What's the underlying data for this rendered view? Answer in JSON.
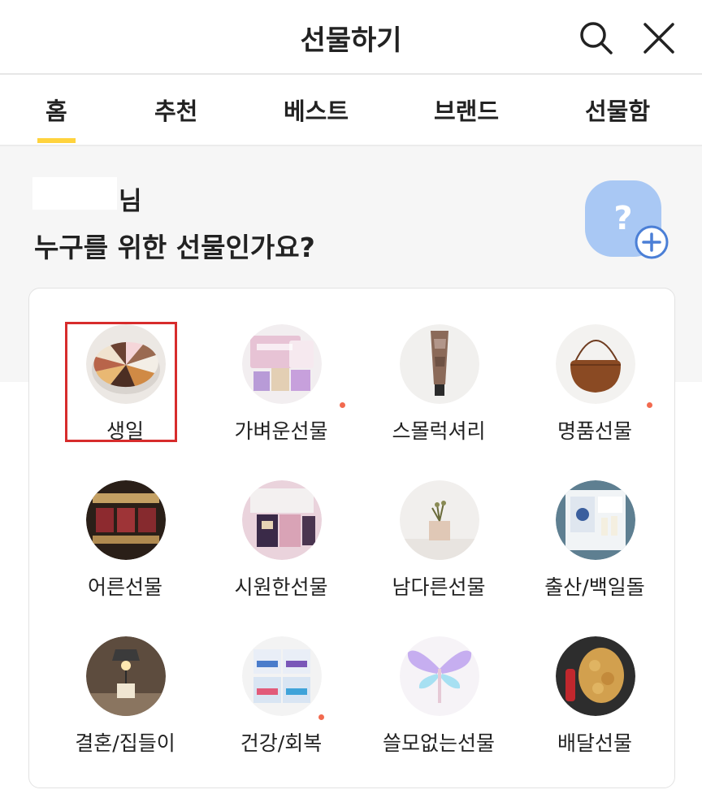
{
  "header": {
    "title": "선물하기",
    "search_icon": "search-icon",
    "close_icon": "close-icon"
  },
  "tabs": [
    {
      "label": "홈",
      "active": true
    },
    {
      "label": "추천",
      "active": false
    },
    {
      "label": "베스트",
      "active": false
    },
    {
      "label": "브랜드",
      "active": false
    },
    {
      "label": "선물함",
      "active": false
    }
  ],
  "greeting": {
    "name_suffix": "님",
    "question": "누구를 위한 선물인가요?",
    "add_friend_icon": "question-add-icon"
  },
  "colors": {
    "accent": "#ffd33d",
    "new_dot": "#f26a4f",
    "selection": "#d72c2c",
    "friend_icon": "#a9c8f4"
  },
  "categories": [
    {
      "label": "생일",
      "has_dot": false,
      "selected": true
    },
    {
      "label": "가벼운선물",
      "has_dot": true,
      "selected": false
    },
    {
      "label": "스몰럭셔리",
      "has_dot": false,
      "selected": false
    },
    {
      "label": "명품선물",
      "has_dot": true,
      "selected": false
    },
    {
      "label": "어른선물",
      "has_dot": false,
      "selected": false
    },
    {
      "label": "시원한선물",
      "has_dot": false,
      "selected": false
    },
    {
      "label": "남다른선물",
      "has_dot": false,
      "selected": false
    },
    {
      "label": "출산/백일돌",
      "has_dot": false,
      "selected": false
    },
    {
      "label": "결혼/집들이",
      "has_dot": false,
      "selected": false
    },
    {
      "label": "건강/회복",
      "has_dot": true,
      "selected": false
    },
    {
      "label": "쓸모없는선물",
      "has_dot": false,
      "selected": false
    },
    {
      "label": "배달선물",
      "has_dot": false,
      "selected": false
    }
  ]
}
